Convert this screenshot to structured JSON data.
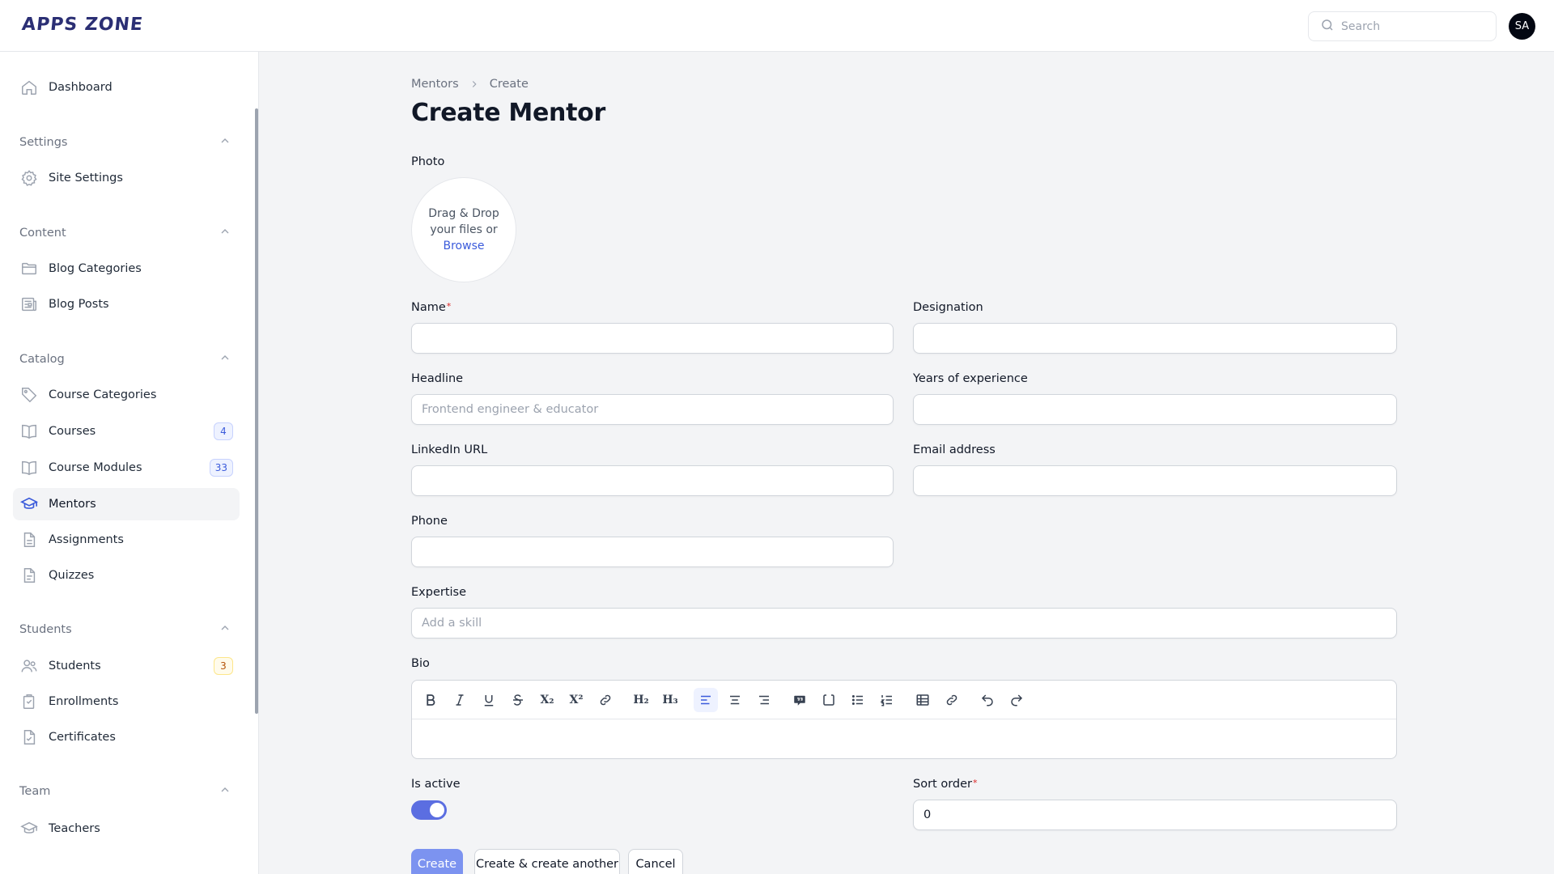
{
  "app": {
    "logo": "APPS ZONE"
  },
  "header": {
    "search_placeholder": "Search",
    "avatar_initials": "SA"
  },
  "sidebar": {
    "dashboard": "Dashboard",
    "groups": {
      "settings": "Settings",
      "content": "Content",
      "catalog": "Catalog",
      "students": "Students",
      "team": "Team"
    },
    "items": {
      "site_settings": "Site Settings",
      "blog_categories": "Blog Categories",
      "blog_posts": "Blog Posts",
      "course_categories": "Course Categories",
      "courses": "Courses",
      "courses_badge": "4",
      "course_modules": "Course Modules",
      "course_modules_badge": "33",
      "mentors": "Mentors",
      "assignments": "Assignments",
      "quizzes": "Quizzes",
      "students": "Students",
      "students_badge": "3",
      "enrollments": "Enrollments",
      "certificates": "Certificates",
      "teachers": "Teachers"
    },
    "active": "mentors"
  },
  "breadcrumb": {
    "parent": "Mentors",
    "current": "Create"
  },
  "page": {
    "title": "Create Mentor"
  },
  "form": {
    "photo": {
      "label": "Photo",
      "line1": "Drag & Drop",
      "line2": "your files or",
      "browse": "Browse"
    },
    "name": {
      "label": "Name",
      "required_mark": "*",
      "value": ""
    },
    "designation": {
      "label": "Designation",
      "value": ""
    },
    "headline": {
      "label": "Headline",
      "placeholder": "Frontend engineer & educator",
      "value": ""
    },
    "years": {
      "label": "Years of experience",
      "value": ""
    },
    "linkedin": {
      "label": "LinkedIn URL",
      "value": ""
    },
    "email": {
      "label": "Email address",
      "value": ""
    },
    "phone": {
      "label": "Phone",
      "value": ""
    },
    "expertise": {
      "label": "Expertise",
      "placeholder": "Add a skill"
    },
    "bio": {
      "label": "Bio",
      "h2": "H₂",
      "h3": "H₃",
      "sub": "X₂",
      "sup": "X²"
    },
    "is_active": {
      "label": "Is active",
      "value": true
    },
    "sort_order": {
      "label": "Sort order",
      "required_mark": "*",
      "value": "0"
    }
  },
  "actions": {
    "create": "Create",
    "create_another": "Create & create another",
    "cancel": "Cancel"
  },
  "colors": {
    "accent": "#5b6ee1",
    "primary_button": "#7c93f0",
    "active_nav": "#f3f4f6"
  }
}
